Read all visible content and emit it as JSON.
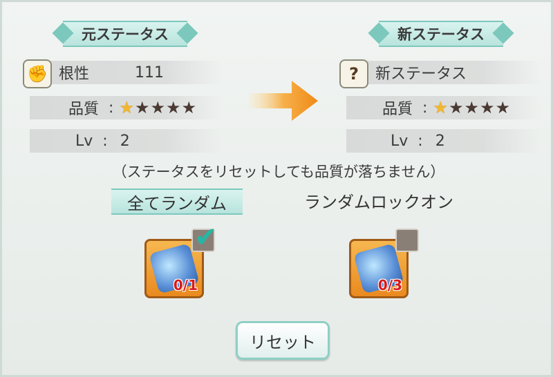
{
  "left": {
    "title": "元ステータス",
    "stat_name": "根性",
    "stat_value": "111",
    "quality_label": "品質",
    "level_label": "Lv",
    "level_value": "2",
    "stars_filled": 1,
    "stars_total": 5,
    "icon": "fist-icon"
  },
  "right": {
    "title": "新ステータス",
    "stat_name": "新ステータス",
    "quality_label": "品質",
    "level_label": "Lv",
    "level_value": "2",
    "stars_filled": 1,
    "stars_total": 5,
    "icon": "question-icon"
  },
  "colon": ":",
  "note": "（ステータスをリセットしても品質が落ちません）",
  "modes": {
    "random_all": "全てランダム",
    "random_lock": "ランダムロックオン"
  },
  "items": {
    "left_count": "0/1",
    "right_count": "0/3",
    "left_checked": true,
    "right_checked": false
  },
  "reset_label": "リセット",
  "colors": {
    "accent": "#7cc8bc",
    "star": "#f2b632",
    "item_bg": "#f0a23a",
    "count": "#d81a1a"
  }
}
